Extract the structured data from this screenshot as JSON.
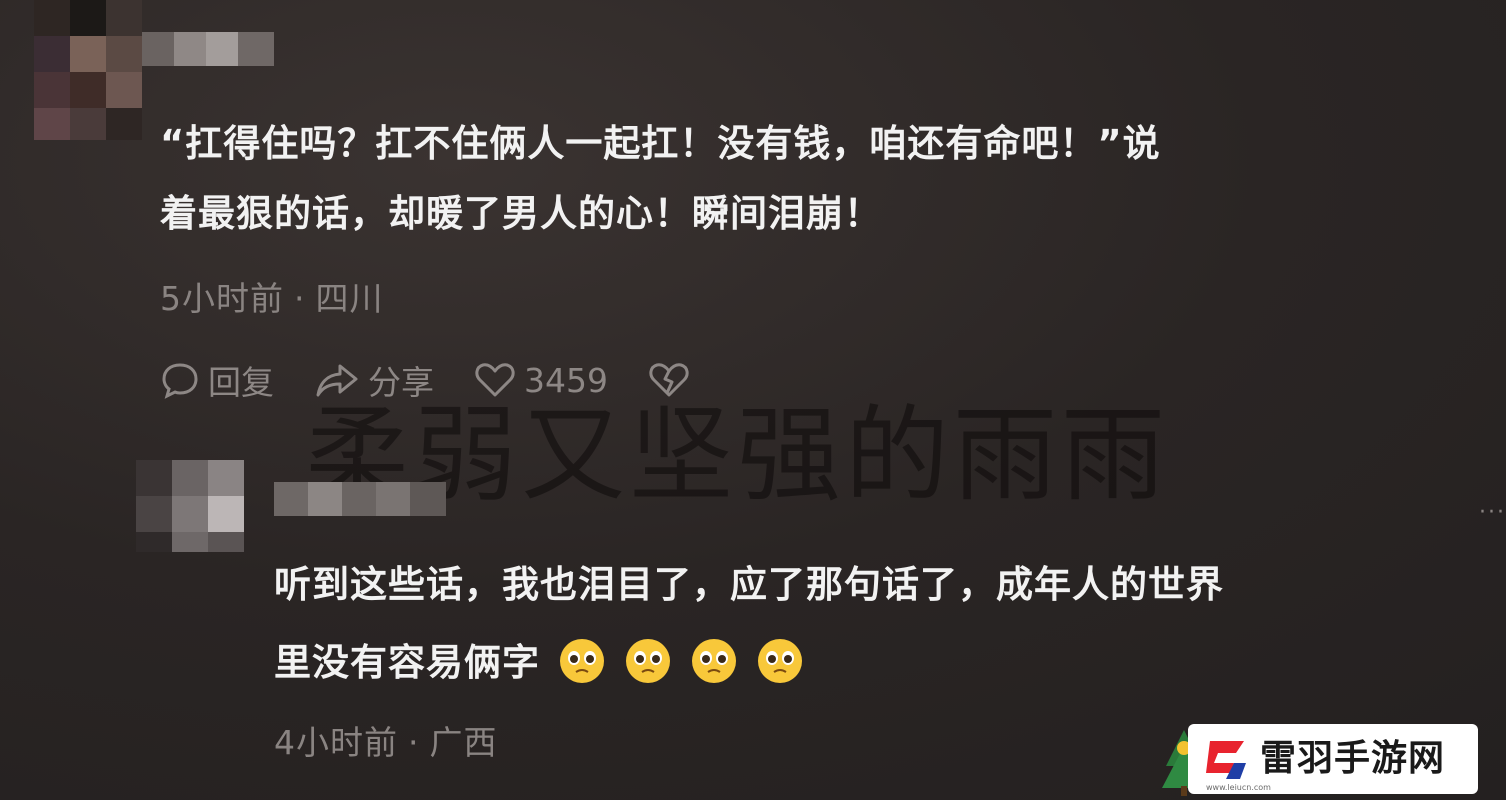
{
  "comments": [
    {
      "text_line1": "“扛得住吗？扛不住俩人一起扛！没有钱，咱还有命吧！”说",
      "text_line2": "着最狠的话，却暖了男人的心！瞬间泪崩！",
      "time": "5小时前",
      "location": "四川",
      "separator": "·",
      "actions": {
        "reply_label": "回复",
        "share_label": "分享",
        "like_count": "3459"
      }
    },
    {
      "text_line1": "听到这些话，我也泪目了，应了那句话了，成年人的世界",
      "text_line2": "里没有容易俩字",
      "emoji_count": 4,
      "time": "4小时前",
      "location": "广西",
      "separator": "·",
      "more_label": "···"
    }
  ],
  "watermark": "柔弱又坚强的雨雨",
  "logo": {
    "name": "雷羽手游网",
    "url": "www.leiucn.com"
  },
  "icons": {
    "reply": "comment-bubble-icon",
    "share": "share-arrow-icon",
    "like": "heart-icon",
    "dislike": "broken-heart-icon",
    "emoji": "pleading-face-icon"
  },
  "colors": {
    "background": "#2a2524",
    "text": "#f2f2f2",
    "meta": "#8a8482",
    "logo_red": "#e8232e",
    "logo_blue": "#1f3ea6"
  }
}
